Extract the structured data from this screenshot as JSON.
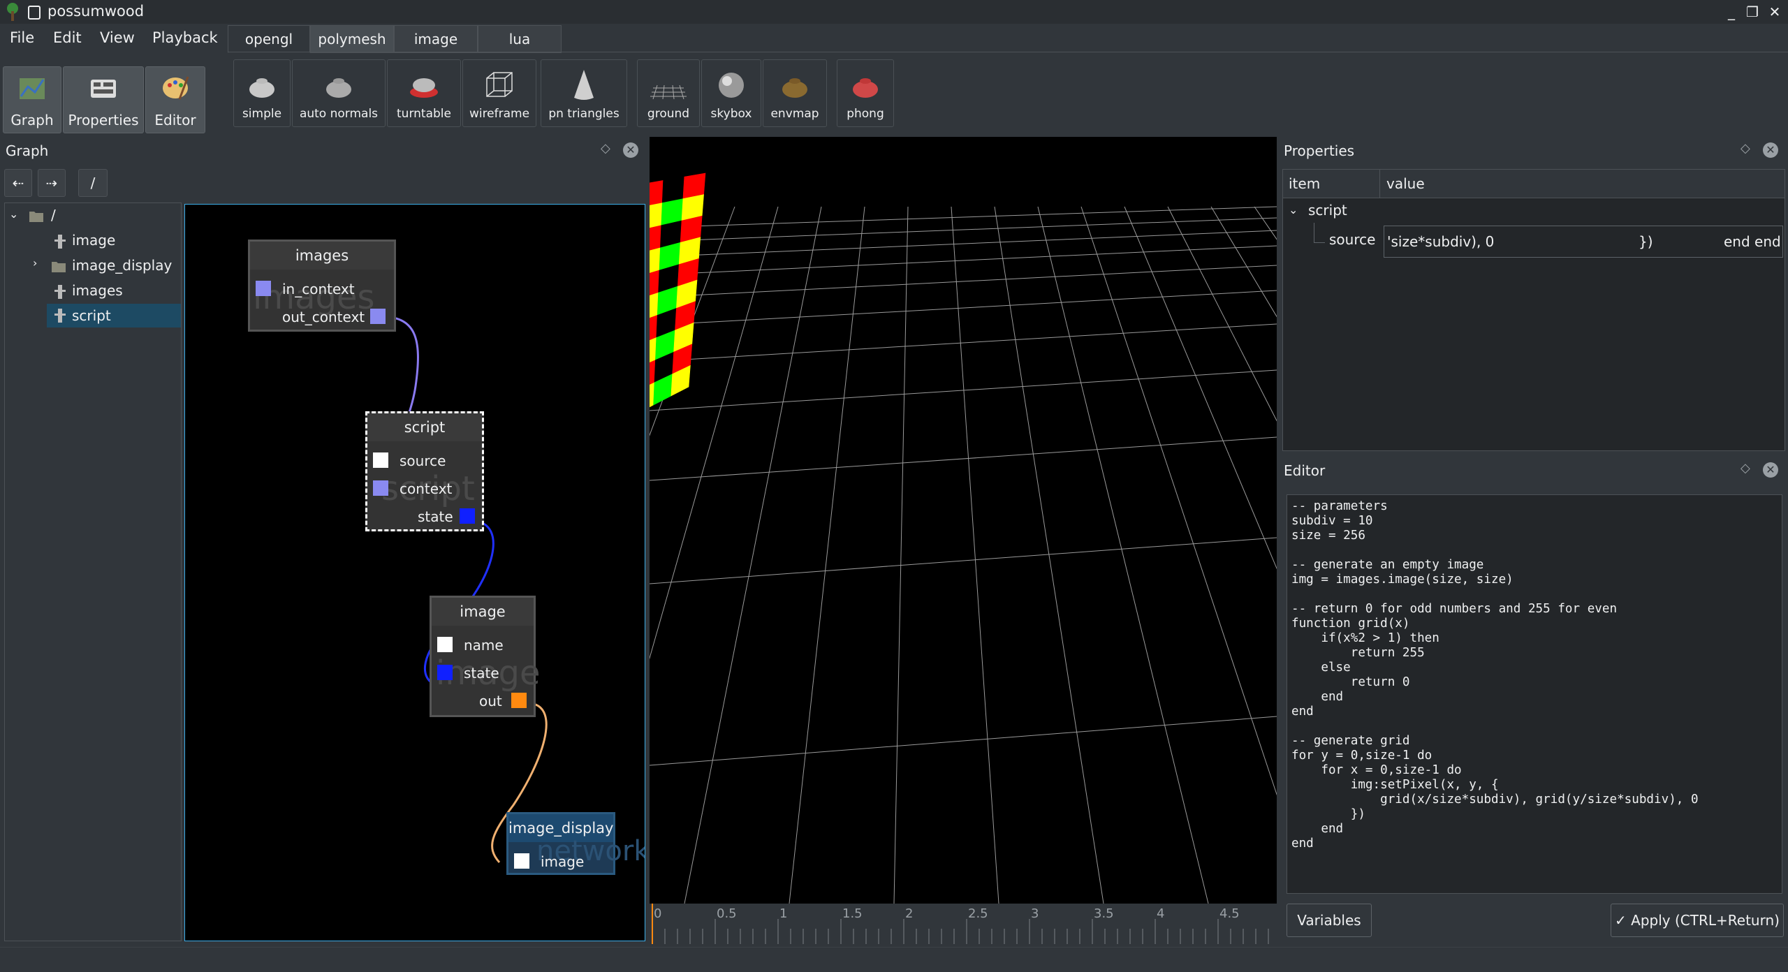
{
  "window": {
    "title": "possumwood"
  },
  "menu": [
    "File",
    "Edit",
    "View",
    "Playback"
  ],
  "mode_buttons": [
    {
      "label": "Graph",
      "icon": "graph-icon"
    },
    {
      "label": "Properties",
      "icon": "properties-icon"
    },
    {
      "label": "Editor",
      "icon": "editor-icon"
    }
  ],
  "shelf": {
    "tabs": [
      "opengl",
      "polymesh",
      "image",
      "lua"
    ],
    "buttons": [
      "simple",
      "auto normals",
      "turntable",
      "wireframe",
      "pn triangles",
      "ground",
      "skybox",
      "envmap",
      "phong"
    ]
  },
  "graph_panel": {
    "title": "Graph",
    "path": "/",
    "tree": [
      "/",
      "image",
      "image_display",
      "images",
      "script"
    ],
    "nodes": {
      "images": {
        "title": "images",
        "watermark": "images",
        "ports": [
          "in_context",
          "out_context"
        ]
      },
      "script": {
        "title": "script",
        "watermark": "script",
        "ports": [
          "source",
          "context",
          "state"
        ]
      },
      "image": {
        "title": "image",
        "watermark": "image",
        "ports": [
          "name",
          "state",
          "out"
        ]
      },
      "image_display": {
        "title": "image_display",
        "watermark": "network",
        "ports": [
          "image"
        ]
      }
    }
  },
  "timeline": {
    "ticks": [
      "0",
      "0.5",
      "1",
      "1.5",
      "2",
      "2.5",
      "3",
      "3.5",
      "4",
      "4.5"
    ]
  },
  "properties_panel": {
    "title": "Properties",
    "headers": [
      "item",
      "value"
    ],
    "group": "script",
    "row": {
      "name": "source",
      "value_start": "'size*subdiv), 0",
      "value_mid": "})",
      "value_end": "end end"
    }
  },
  "editor_panel": {
    "title": "Editor",
    "code": "-- parameters\nsubdiv = 10\nsize = 256\n\n-- generate an empty image\nimg = images.image(size, size)\n\n-- return 0 for odd numbers and 255 for even\nfunction grid(x)\n    if(x%2 > 1) then\n        return 255\n    else\n        return 0\n    end\nend\n\n-- generate grid\nfor y = 0,size-1 do\n    for x = 0,size-1 do\n        img:setPixel(x, y, {\n            grid(x/size*subdiv), grid(y/size*subdiv), 0\n        })\n    end\nend",
    "variables_label": "Variables",
    "apply_label": "✓ Apply (CTRL+Return)"
  },
  "colors": {
    "red": "#ff0000",
    "green": "#00ff00",
    "yellow": "#ffff00",
    "selection": "#1d4a63",
    "accent": "#3daee9"
  }
}
